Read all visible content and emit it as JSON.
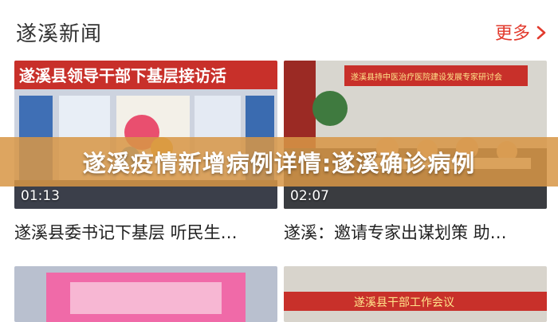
{
  "header": {
    "title": "遂溪新闻",
    "more_label": "更多"
  },
  "videos": [
    {
      "duration": "01:13",
      "caption": "遂溪县委书记下基层 听民生…",
      "scene_title": "遂溪县领导干部下基层接访活"
    },
    {
      "duration": "02:07",
      "caption": "遂溪：邀请专家出谋划策 助…",
      "scene_title": "遂溪县持中医治疗医院建设发展专家研讨会"
    },
    {
      "duration": "",
      "caption": "",
      "scene_title": ""
    },
    {
      "duration": "",
      "caption": "",
      "scene_title": "遂溪县干部工作会议"
    }
  ],
  "overlay": {
    "banner_text": "遂溪疫情新增病例详情:遂溪确诊病例"
  },
  "colors": {
    "accent": "#e23b2e",
    "banner": "#d7964a"
  }
}
